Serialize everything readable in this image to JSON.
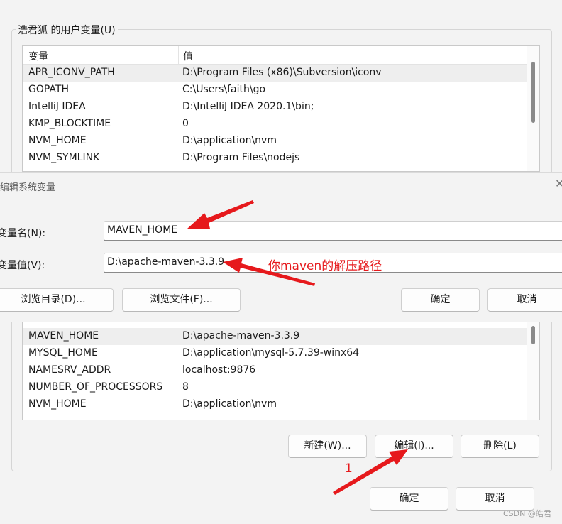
{
  "user_vars": {
    "group_title": "浩君狐 的用户变量(U)",
    "columns": [
      "变量",
      "值"
    ],
    "rows": [
      {
        "name": "APR_ICONV_PATH",
        "value": "D:\\Program Files (x86)\\Subversion\\iconv",
        "selected": true
      },
      {
        "name": "GOPATH",
        "value": "C:\\Users\\faith\\go"
      },
      {
        "name": "IntelliJ IDEA",
        "value": "D:\\IntelliJ IDEA 2020.1\\bin;"
      },
      {
        "name": "KMP_BLOCKTIME",
        "value": "0"
      },
      {
        "name": "NVM_HOME",
        "value": "D:\\application\\nvm"
      },
      {
        "name": "NVM_SYMLINK",
        "value": "D:\\Program Files\\nodejs"
      }
    ]
  },
  "edit_dialog": {
    "title": "编辑系统变量",
    "close_glyph": "✕",
    "name_label": "变量名(N):",
    "name_value": "MAVEN_HOME",
    "value_label": "变量值(V):",
    "value_value": "D:\\apache-maven-3.3.9",
    "browse_dir_label": "浏览目录(D)...",
    "browse_file_label": "浏览文件(F)...",
    "ok_label": "确定",
    "cancel_label": "取消"
  },
  "system_vars": {
    "rows": [
      {
        "name": "MAVEN_HOME",
        "value": "D:\\apache-maven-3.3.9",
        "selected": true
      },
      {
        "name": "MYSQL_HOME",
        "value": "D:\\application\\mysql-5.7.39-winx64"
      },
      {
        "name": "NAMESRV_ADDR",
        "value": "localhost:9876"
      },
      {
        "name": "NUMBER_OF_PROCESSORS",
        "value": "8"
      },
      {
        "name": "NVM_HOME",
        "value": "D:\\application\\nvm"
      }
    ],
    "new_label": "新建(W)...",
    "edit_label": "编辑(I)...",
    "delete_label": "删除(L)"
  },
  "footer": {
    "ok_label": "确定",
    "cancel_label": "取消"
  },
  "annotations": {
    "path_note": "你maven的解压路径",
    "step_number": "1",
    "color": "#e6191c"
  },
  "watermark": "CSDN @皓君",
  "icons": [
    "close-icon",
    "red-arrow-annotation"
  ]
}
